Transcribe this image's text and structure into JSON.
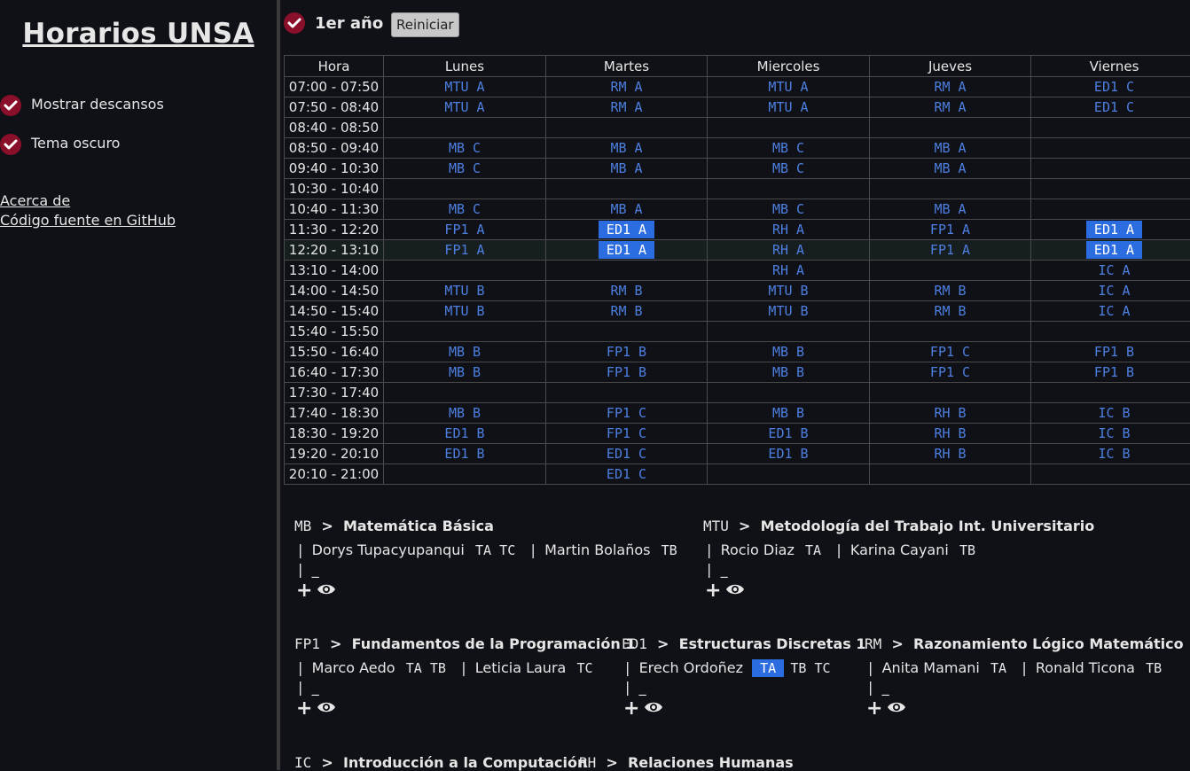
{
  "sidebar": {
    "title": "Horarios UNSA",
    "options": [
      {
        "label": "Mostrar descansos",
        "checked": true
      },
      {
        "label": "Tema oscuro",
        "checked": true
      }
    ],
    "links": [
      "Acerca de",
      "Código fuente en GitHub"
    ]
  },
  "header": {
    "year_label": "1er año",
    "year_checked": true,
    "reset_label": "Reiniciar"
  },
  "schedule": {
    "columns": [
      "Hora",
      "Lunes",
      "Martes",
      "Miercoles",
      "Jueves",
      "Viernes"
    ],
    "rows": [
      {
        "hour": "07:00 - 07:50",
        "cells": [
          "MTU A",
          "RM A",
          "MTU A",
          "RM A",
          "ED1 C"
        ]
      },
      {
        "hour": "07:50 - 08:40",
        "cells": [
          "MTU A",
          "RM A",
          "MTU A",
          "RM A",
          "ED1 C"
        ]
      },
      {
        "hour": "08:40 - 08:50",
        "cells": [
          "",
          "",
          "",
          "",
          ""
        ]
      },
      {
        "hour": "08:50 - 09:40",
        "cells": [
          "MB C",
          "MB A",
          "MB C",
          "MB A",
          ""
        ]
      },
      {
        "hour": "09:40 - 10:30",
        "cells": [
          "MB C",
          "MB A",
          "MB C",
          "MB A",
          ""
        ]
      },
      {
        "hour": "10:30 - 10:40",
        "cells": [
          "",
          "",
          "",
          "",
          ""
        ]
      },
      {
        "hour": "10:40 - 11:30",
        "cells": [
          "MB C",
          "MB A",
          "MB C",
          "MB A",
          ""
        ]
      },
      {
        "hour": "11:30 - 12:20",
        "cells": [
          "FP1 A",
          "ED1 A",
          "RH A",
          "FP1 A",
          "ED1 A"
        ],
        "selected": [
          1,
          4
        ]
      },
      {
        "hour": "12:20 - 13:10",
        "cells": [
          "FP1 A",
          "ED1 A",
          "RH A",
          "FP1 A",
          "ED1 A"
        ],
        "selected": [
          1,
          4
        ],
        "highlight": true
      },
      {
        "hour": "13:10 - 14:00",
        "cells": [
          "",
          "",
          "RH A",
          "",
          "IC A"
        ]
      },
      {
        "hour": "14:00 - 14:50",
        "cells": [
          "MTU B",
          "RM B",
          "MTU B",
          "RM B",
          "IC A"
        ]
      },
      {
        "hour": "14:50 - 15:40",
        "cells": [
          "MTU B",
          "RM B",
          "MTU B",
          "RM B",
          "IC A"
        ]
      },
      {
        "hour": "15:40 - 15:50",
        "cells": [
          "",
          "",
          "",
          "",
          ""
        ]
      },
      {
        "hour": "15:50 - 16:40",
        "cells": [
          "MB B",
          "FP1 B",
          "MB B",
          "FP1 C",
          "FP1 B"
        ]
      },
      {
        "hour": "16:40 - 17:30",
        "cells": [
          "MB B",
          "FP1 B",
          "MB B",
          "FP1 C",
          "FP1 B"
        ]
      },
      {
        "hour": "17:30 - 17:40",
        "cells": [
          "",
          "",
          "",
          "",
          ""
        ]
      },
      {
        "hour": "17:40 - 18:30",
        "cells": [
          "MB B",
          "FP1 C",
          "MB B",
          "RH B",
          "IC B"
        ]
      },
      {
        "hour": "18:30 - 19:20",
        "cells": [
          "ED1 B",
          "FP1 C",
          "ED1 B",
          "RH B",
          "IC B"
        ]
      },
      {
        "hour": "19:20 - 20:10",
        "cells": [
          "ED1 B",
          "ED1 C",
          "ED1 B",
          "RH B",
          "IC B"
        ]
      },
      {
        "hour": "20:10 - 21:00",
        "cells": [
          "",
          "ED1 C",
          "",
          "",
          ""
        ]
      }
    ]
  },
  "courses": [
    {
      "code": "MB",
      "name": "Matemática Básica",
      "teachers": [
        {
          "name": "Dorys Tupacyupanqui",
          "groups": [
            "TA",
            "TC"
          ]
        },
        {
          "name": "Martin Bolaños",
          "groups": [
            "TB"
          ]
        }
      ]
    },
    {
      "code": "MTU",
      "name": "Metodología del Trabajo Int. Universitario",
      "teachers": [
        {
          "name": "Rocio Diaz",
          "groups": [
            "TA"
          ]
        },
        {
          "name": "Karina Cayani",
          "groups": [
            "TB"
          ]
        }
      ]
    },
    {
      "code": "FP1",
      "name": "Fundamentos de la Programación 1",
      "teachers": [
        {
          "name": "Marco Aedo",
          "groups": [
            "TA",
            "TB"
          ]
        },
        {
          "name": "Leticia Laura",
          "groups": [
            "TC"
          ]
        }
      ]
    },
    {
      "code": "ED1",
      "name": "Estructuras Discretas 1",
      "teachers": [
        {
          "name": "Erech Ordoñez",
          "groups": [
            "TA",
            "TB",
            "TC"
          ],
          "selected": 0
        }
      ]
    },
    {
      "code": "RM",
      "name": "Razonamiento Lógico Matemático",
      "teachers": [
        {
          "name": "Anita Mamani",
          "groups": [
            "TA"
          ]
        },
        {
          "name": "Ronald Ticona",
          "groups": [
            "TB"
          ]
        }
      ]
    },
    {
      "code": "IC",
      "name": "Introducción a la Computación",
      "teachers": []
    },
    {
      "code": "RH",
      "name": "Relaciones Humanas",
      "teachers": []
    }
  ],
  "separator": "|",
  "arrow": ">",
  "placeholder": "_",
  "icons": {
    "check": "check-icon",
    "add": "plus-icon",
    "view": "eye-icon"
  },
  "colors": {
    "accent": "#8a0f2a",
    "link_blue": "#4d7fe0",
    "selected_bg": "#2b6de0"
  }
}
